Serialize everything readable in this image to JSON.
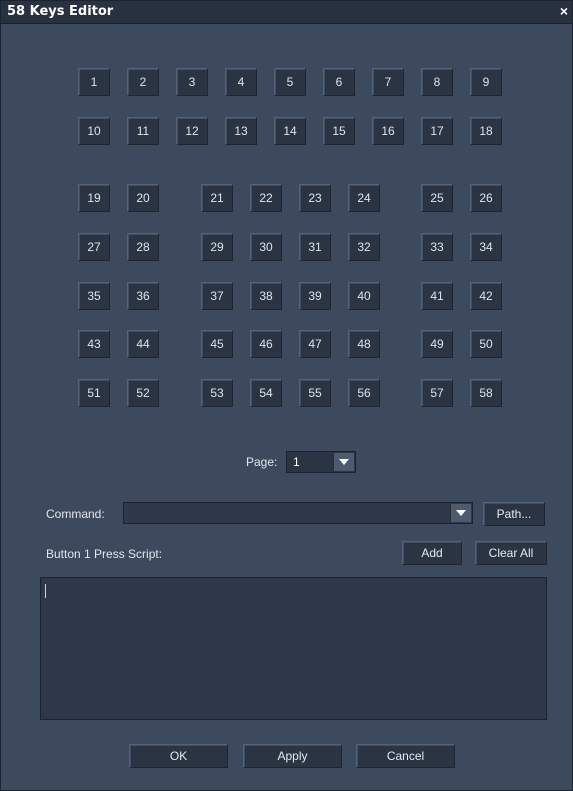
{
  "window": {
    "title": "58 Keys Editor",
    "close_glyph": "×"
  },
  "keys": [
    "1",
    "2",
    "3",
    "4",
    "5",
    "6",
    "7",
    "8",
    "9",
    "10",
    "11",
    "12",
    "13",
    "14",
    "15",
    "16",
    "17",
    "18",
    "19",
    "20",
    "21",
    "22",
    "23",
    "24",
    "25",
    "26",
    "27",
    "28",
    "29",
    "30",
    "31",
    "32",
    "33",
    "34",
    "35",
    "36",
    "37",
    "38",
    "39",
    "40",
    "41",
    "42",
    "43",
    "44",
    "45",
    "46",
    "47",
    "48",
    "49",
    "50",
    "51",
    "52",
    "53",
    "54",
    "55",
    "56",
    "57",
    "58"
  ],
  "page": {
    "label": "Page:",
    "value": "1"
  },
  "command": {
    "label": "Command:",
    "value": "",
    "path_button": "Path..."
  },
  "script": {
    "label": "Button 1 Press Script:",
    "add_button": "Add",
    "clear_all_button": "Clear All",
    "text": ""
  },
  "footer": {
    "ok": "OK",
    "apply": "Apply",
    "cancel": "Cancel"
  }
}
